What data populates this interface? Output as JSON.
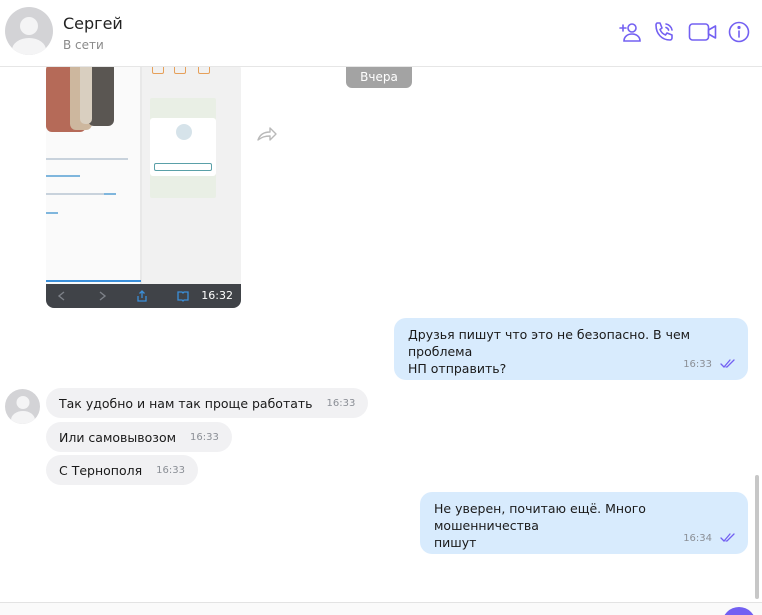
{
  "header": {
    "name": "Сергей",
    "status": "В сети",
    "icons": [
      "add-contact-icon",
      "phone-icon",
      "video-icon",
      "info-icon"
    ]
  },
  "colors": {
    "accent": "#7360f2",
    "outgoing_bubble": "#d8ebfd",
    "incoming_bubble": "#f1f1f3",
    "date_pill": "#a3a3a3"
  },
  "chat": {
    "date_separator": "Вчера",
    "image_message": {
      "time": "16:32"
    },
    "messages": [
      {
        "direction": "out",
        "text": "Друзья пишут что это не безопасно. В чем проблема\nНП отправить?",
        "time": "16:33",
        "read": true
      },
      {
        "direction": "in",
        "text": "Так удобно и нам так проще работать",
        "time": "16:33"
      },
      {
        "direction": "in",
        "text": "Или самовывозом",
        "time": "16:33"
      },
      {
        "direction": "in",
        "text": "С Тернополя",
        "time": "16:33"
      },
      {
        "direction": "out",
        "text": "Не уверен, почитаю ещё. Много мошенничества\nпишут",
        "time": "16:34",
        "read": true
      }
    ]
  }
}
